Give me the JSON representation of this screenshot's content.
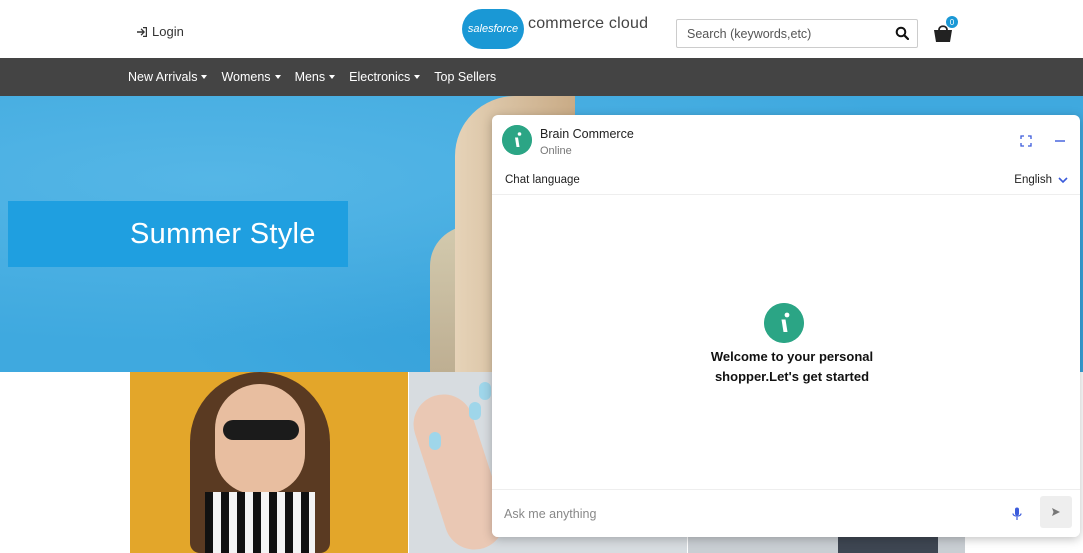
{
  "header": {
    "login_label": "Login",
    "brand_cloud_text": "salesforce",
    "brand_text": "commerce cloud",
    "search": {
      "placeholder": "Search (keywords,etc)",
      "value": ""
    },
    "cart_count": "0"
  },
  "nav": {
    "items": [
      {
        "label": "New Arrivals",
        "has_dropdown": true
      },
      {
        "label": "Womens",
        "has_dropdown": true
      },
      {
        "label": "Mens",
        "has_dropdown": true
      },
      {
        "label": "Electronics",
        "has_dropdown": true
      },
      {
        "label": "Top Sellers",
        "has_dropdown": false
      }
    ]
  },
  "hero": {
    "title": "Summer Style"
  },
  "chat": {
    "agent_name": "Brain Commerce",
    "agent_status": "Online",
    "language_label": "Chat language",
    "language_value": "English",
    "welcome_text": "Welcome to your personal shopper.Let's get started",
    "input_placeholder": "Ask me anything",
    "input_value": ""
  },
  "colors": {
    "brand_blue": "#1a98d5",
    "nav_bg": "#444444",
    "hero_bg": "#3fa9df",
    "chat_accent": "#2ba585",
    "mic_color": "#3b5bdb"
  }
}
